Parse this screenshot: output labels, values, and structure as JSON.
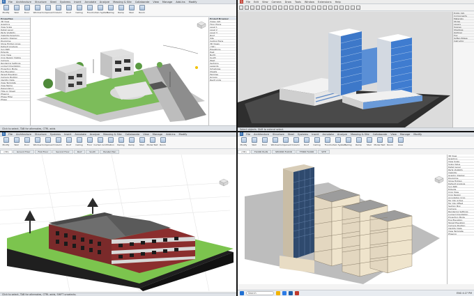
{
  "colors": {
    "ribbon_bg": "#f7f7f7",
    "revit_blue": "#1f5fa8",
    "grass": "#6ab04c",
    "brick": "#8b2e2e",
    "soil": "#2a2a2a",
    "glass": "#3d78c9",
    "beige": "#e8dcc4"
  },
  "q1": {
    "app_title": "Autodesk Revit",
    "tabs": [
      "File",
      "Architecture",
      "Structure",
      "Steel",
      "Systems",
      "Insert",
      "Annotate",
      "Analyze",
      "Massing & Site",
      "Collaborate",
      "View",
      "Manage",
      "Add-Ins",
      "Modify"
    ],
    "ribbon": [
      "Modify",
      "Wall",
      "Door",
      "Window",
      "Component",
      "Column",
      "Roof",
      "Ceiling",
      "Floor",
      "Curtain System",
      "Railing",
      "Ramp",
      "Stair",
      "Room"
    ],
    "properties_header": "Properties",
    "properties_rows": [
      "3D View",
      "Graphics",
      "View Scale",
      "Detail Level",
      "Parts Visibility",
      "Visibility/Graphics",
      "Graphic Display",
      "Discipline",
      "Show Hidden Lines",
      "Default Analysis",
      "Sun Path",
      "Extents",
      "Crop View",
      "Crop Region Visible",
      "Camera",
      "Rendering Settings",
      "Locked Orientation",
      "Projection Mode",
      "Eye Elevation",
      "Target Elevation",
      "Camera Position",
      "Identity Data",
      "View Template",
      "View Name",
      "Dependency",
      "Title on Sheet",
      "Phasing",
      "Phase Filter",
      "Phase"
    ],
    "browser_header": "Project Browser",
    "browser_rows": [
      "Views (all)",
      "Floor Plans",
      "Level 1",
      "Level 2",
      "Level 3",
      "Roof",
      "Site",
      "Ceiling Plans",
      "3D Views",
      "{3D}",
      "Elevations",
      "East",
      "North",
      "South",
      "West",
      "Sections",
      "Legends",
      "Schedules",
      "Sheets",
      "Families",
      "Groups",
      "Revit Links"
    ],
    "status": "Click to select, TAB for alternates, CTRL adds"
  },
  "q2": {
    "app_title": "SketchUp",
    "menus": [
      "File",
      "Edit",
      "View",
      "Camera",
      "Draw",
      "Tools",
      "Window",
      "Extensions",
      "Help"
    ],
    "tray_rows": [
      "Entity Info",
      "Components",
      "Materials",
      "Styles",
      "Layers",
      "Scenes",
      "Shadows",
      "Outliner",
      "Fog",
      "Soften Edges",
      "Instructor"
    ],
    "status": "Select objects. Shift to extend select."
  },
  "q3": {
    "app_title": "Autodesk Revit",
    "tabs": [
      "File",
      "Architecture",
      "Structure",
      "Systems",
      "Insert",
      "Annotate",
      "Analyze",
      "Massing & Site",
      "Collaborate",
      "View",
      "Manage",
      "Add-Ins",
      "Modify"
    ],
    "ribbon": [
      "Modify",
      "Wall",
      "Door",
      "Window",
      "Component",
      "Column",
      "Roof",
      "Ceiling",
      "Floor",
      "Curtain Grid",
      "Mullion",
      "Railing",
      "Ramp",
      "Stair",
      "Model Text",
      "Room"
    ],
    "view_tabs": [
      "{3D}",
      "Ground Floor",
      "First Floor",
      "Second Floor",
      "Roof",
      "South",
      "Parallel Plan"
    ],
    "status": "Click to select, TAB for alternates, CTRL adds, SHIFT unselects."
  },
  "q4": {
    "app_title": "Autodesk Revit",
    "tabs": [
      "File",
      "Architecture",
      "Structure",
      "Steel",
      "Systems",
      "Insert",
      "Annotate",
      "Analyze",
      "Massing & Site",
      "Collaborate",
      "View",
      "Manage",
      "Modify"
    ],
    "ribbon": [
      "Modify",
      "Wall",
      "Door",
      "Window",
      "Component",
      "Column",
      "Roof",
      "Ceiling",
      "Floor",
      "Curtain System",
      "Railing",
      "Ramp",
      "Stair",
      "Model Text",
      "Room",
      "Area"
    ],
    "view_tabs": [
      "{3D}",
      "FLOOR PLAN",
      "SECOND FLOOR",
      "THIRD FLOOR",
      "SITE"
    ],
    "properties_rows": [
      "3D View",
      "Graphics",
      "View Scale",
      "Scale Value",
      "Detail Level",
      "Parts Visibility",
      "Visibility",
      "Graphic Display",
      "Discipline",
      "Show Hidden",
      "Default Analysis",
      "Sun Path",
      "Extents",
      "Crop View",
      "Crop Region",
      "Annotation Crop",
      "Far Clip Active",
      "Far Clip Offset",
      "Section Box",
      "Camera",
      "Rendering Settings",
      "Locked Orientation",
      "Projection Mode",
      "Eye Elevation",
      "Target Elevation",
      "Camera Position",
      "Identity Data",
      "View Template",
      "Phasing"
    ],
    "search_placeholder": "Search",
    "clock": "ENG 4:27 PM"
  }
}
